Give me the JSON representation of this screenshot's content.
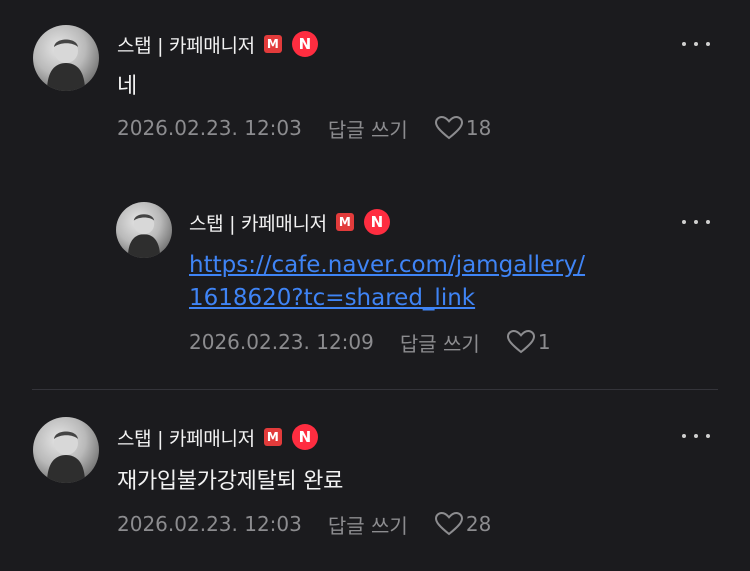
{
  "comments": [
    {
      "nickname": "스탭 | 카페매니저",
      "badge_m": "M",
      "badge_n": "N",
      "text": "네",
      "date": "2026.02.23. 12:03",
      "reply_label": "답글 쓰기",
      "likes": "18"
    },
    {
      "nickname": "스탭 | 카페매니저",
      "badge_m": "M",
      "badge_n": "N",
      "link_line1": "https://cafe.naver.com/jamgallery/",
      "link_line2": "1618620?tc=shared_link",
      "date": "2026.02.23. 12:09",
      "reply_label": "답글 쓰기",
      "likes": "1"
    },
    {
      "nickname": "스탭 | 카페매니저",
      "badge_m": "M",
      "badge_n": "N",
      "text": "재가입불가강제탈퇴 완료",
      "date": "2026.02.23. 12:03",
      "reply_label": "답글 쓰기",
      "likes": "28"
    }
  ],
  "colors": {
    "background": "#1b1b1e",
    "link": "#3f84f5",
    "badge_red": "#ff2d40",
    "meta_text": "#8c8c8f"
  },
  "icons": {
    "more": "more-dots-icon",
    "like": "heart-outline-icon",
    "manager": "manager-m-icon",
    "new": "new-n-icon"
  }
}
